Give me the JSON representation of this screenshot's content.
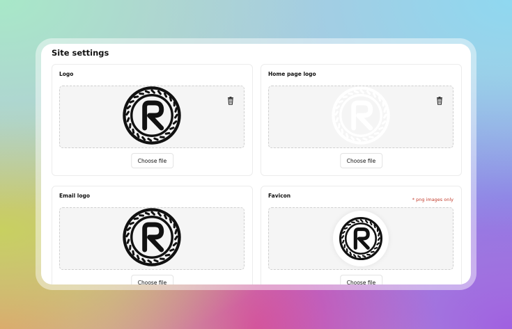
{
  "page": {
    "title": "Site settings"
  },
  "cards": [
    {
      "label": "Logo",
      "button": "Choose file",
      "has_delete": true,
      "logo_style": "dark"
    },
    {
      "label": "Home page logo",
      "button": "Choose file",
      "has_delete": true,
      "logo_style": "white"
    },
    {
      "label": "Email logo",
      "button": "Choose file",
      "has_delete": false,
      "logo_style": "dark"
    },
    {
      "label": "Favicon",
      "note": "* png images only",
      "button": "Choose file",
      "has_delete": false,
      "logo_style": "dark-on-white-circle"
    }
  ],
  "icons": {
    "delete": "trash-icon",
    "logo": "brand-logo-icon"
  },
  "colors": {
    "note": "#c23a2a",
    "drop_zone": "#f5f5f5",
    "logo_dark": "#111111"
  }
}
